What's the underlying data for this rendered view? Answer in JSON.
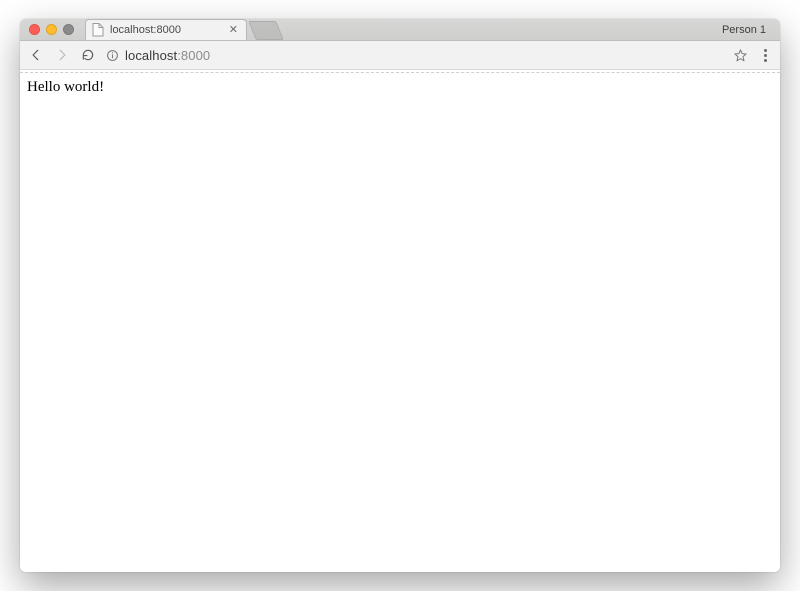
{
  "window": {
    "profile_label": "Person 1"
  },
  "tab": {
    "title": "localhost:8000"
  },
  "address": {
    "host": "localhost",
    "port_suffix": ":8000"
  },
  "page": {
    "body_text": "Hello world!"
  }
}
